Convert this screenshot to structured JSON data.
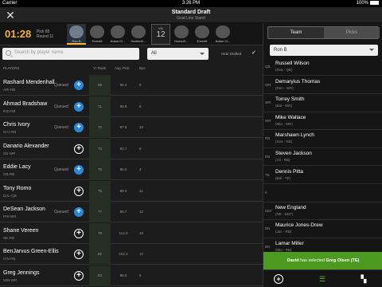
{
  "status_bar": {
    "carrier": "Carrier",
    "time": "3:26 PM",
    "battery": "100%"
  },
  "header": {
    "title": "Standard Draft",
    "subtitle": "Goal Line Stand"
  },
  "pick_bar": {
    "timer": "01:28",
    "pick": "Pick 85",
    "round": "Round 11",
    "slots": [
      "Ron B",
      "Everett",
      "Adam Cl...",
      "HarlemK...",
      "Wk",
      "HomerK...",
      "Everett",
      "Adam Cl..."
    ],
    "calendar": {
      "label": "Wk",
      "number": "12"
    }
  },
  "filters": {
    "search_placeholder": "Search by player name",
    "position_filter": "All",
    "hide_drafted_label": "Hide Drafted",
    "hide_drafted_checked": "✓"
  },
  "table": {
    "columns": {
      "players": "PLAYERS",
      "yr_rank": "Yr Rank",
      "avg_pick": "Avg. Pick",
      "bye": "Bye"
    },
    "rows": [
      {
        "name": "Rashard Mendenhall",
        "pos": "ARI-RB",
        "status": "Queued",
        "yr_rank": "69",
        "avg_pick": "96.2",
        "bye": "9"
      },
      {
        "name": "Ahmad Bradshaw",
        "pos": "IND-RB",
        "status": "Queued",
        "yr_rank": "71",
        "avg_pick": "96.9",
        "bye": "8"
      },
      {
        "name": "Chris Ivory",
        "pos": "NYJ-RB",
        "status": "Queued",
        "yr_rank": "72",
        "avg_pick": "97.6",
        "bye": "10"
      },
      {
        "name": "Danario Alexander",
        "pos": "SD-WR",
        "status": "",
        "yr_rank": "74",
        "avg_pick": "80.7",
        "bye": "8"
      },
      {
        "name": "Eddie Lacy",
        "pos": "GB-RB",
        "status": "Queued",
        "yr_rank": "75",
        "avg_pick": "85.2",
        "bye": "4"
      },
      {
        "name": "Tony Romo",
        "pos": "DAL-QB",
        "status": "",
        "yr_rank": "76",
        "avg_pick": "89.3",
        "bye": "11"
      },
      {
        "name": "DeSean Jackson",
        "pos": "PHI-WR",
        "status": "Queued",
        "yr_rank": "77",
        "avg_pick": "85.7",
        "bye": "12"
      },
      {
        "name": "Shane Vereen",
        "pos": "NE-RB",
        "status": "",
        "yr_rank": "78",
        "avg_pick": "114.0",
        "bye": "10"
      },
      {
        "name": "BenJarvus Green-Ellis",
        "pos": "CIN-RB",
        "status": "",
        "yr_rank": "82",
        "avg_pick": "102.2",
        "bye": "12"
      },
      {
        "name": "Greg Jennings",
        "pos": "MIN-WR",
        "status": "",
        "yr_rank": "83",
        "avg_pick": "88.8",
        "bye": "5"
      }
    ]
  },
  "right_panel": {
    "tabs": [
      "Team",
      "Picks"
    ],
    "team_select": "Ron B",
    "roster": [
      {
        "pos": "QB",
        "name": "Russell Wilson",
        "team": "(Sea - QB)"
      },
      {
        "pos": "WR",
        "name": "Demaryius Thomas",
        "team": "(Den - WR)"
      },
      {
        "pos": "WR",
        "name": "Torrey Smith",
        "team": "(Bal - WR)"
      },
      {
        "pos": "WR",
        "name": "Mike Wallace",
        "team": "(Mia - WR)"
      },
      {
        "pos": "RB",
        "name": "Marshawn Lynch",
        "team": "(Sea - RB)"
      },
      {
        "pos": "RB",
        "name": "Steven Jackson",
        "team": "(Atl - RB)"
      },
      {
        "pos": "TE",
        "name": "Dennis Pitta",
        "team": "(Bal - TE)"
      },
      {
        "pos": "K",
        "name": "",
        "team": ""
      },
      {
        "pos": "DEF",
        "name": "New England",
        "team": "(NE - DEF)"
      },
      {
        "pos": "BN",
        "name": "Maurice Jones-Drew",
        "team": "(Jac - RB)"
      },
      {
        "pos": "BN",
        "name": "Lamar Miller",
        "team": "(Mia - RB)"
      }
    ],
    "toast_prefix": "David",
    "toast_middle": " has selected ",
    "toast_player": "Greg Olsen (TE)"
  }
}
